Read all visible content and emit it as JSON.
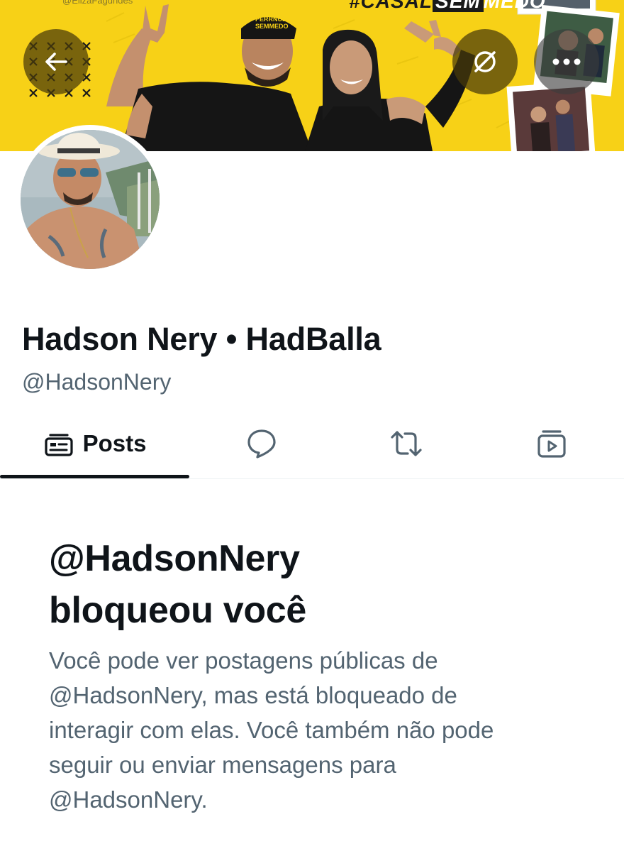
{
  "banner": {
    "watermark_handle": "@ElizaFagundes",
    "hashtag_part1": "#CASAL",
    "hashtag_part2": "SEM",
    "hashtag_part3": "MEDO",
    "cap_text_line1": "PERRNUD",
    "cap_text_line2": "SEMMEDO",
    "background_color": "#f7d117"
  },
  "toolbar": {
    "back_icon": "arrow-left-icon",
    "grok_icon": "grok-icon",
    "more_icon": "more-dots-icon"
  },
  "profile": {
    "display_name": "Hadson Nery • HadBalla",
    "username": "@HadsonNery"
  },
  "tabs": [
    {
      "label": "Posts",
      "icon": "posts-icon",
      "selected": true
    },
    {
      "label": "",
      "icon": "replies-icon",
      "selected": false
    },
    {
      "label": "",
      "icon": "reposts-icon",
      "selected": false
    },
    {
      "label": "",
      "icon": "media-icon",
      "selected": false
    }
  ],
  "blocked": {
    "title_line1": "@HadsonNery",
    "title_line2": "bloqueou você",
    "body_line1": "Você pode ver postagens públicas de",
    "body_line2": "@HadsonNery, mas está bloqueado de",
    "body_line3": "interagir com elas. Você também não pode",
    "body_line4": "seguir ou enviar mensagens para",
    "body_line5": "@HadsonNery."
  },
  "colors": {
    "text_primary": "#0f1419",
    "text_secondary": "#536471",
    "divider": "#eff3f4"
  }
}
